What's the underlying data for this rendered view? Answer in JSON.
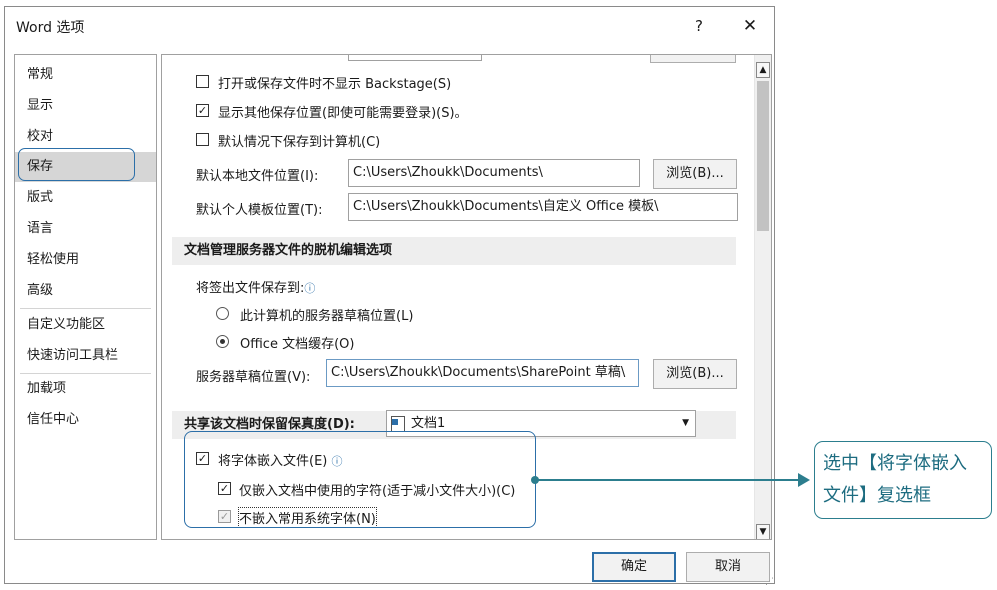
{
  "window": {
    "title": "Word 选项",
    "help": "?",
    "close": "✕"
  },
  "sidebar": {
    "items": [
      {
        "label": "常规"
      },
      {
        "label": "显示"
      },
      {
        "label": "校对"
      },
      {
        "label": "保存",
        "selected": true
      },
      {
        "label": "版式"
      },
      {
        "label": "语言"
      },
      {
        "label": "轻松使用"
      },
      {
        "label": "高级"
      },
      {
        "label": "自定义功能区"
      },
      {
        "label": "快速访问工具栏"
      },
      {
        "label": "加载项"
      },
      {
        "label": "信任中心"
      }
    ]
  },
  "save": {
    "no_backstage": {
      "label": "打开或保存文件时不显示 Backstage(S)",
      "checked": false
    },
    "show_locations": {
      "label": "显示其他保存位置(即使可能需要登录)(S)。",
      "checked": true
    },
    "default_local": {
      "label": "默认情况下保存到计算机(C)",
      "checked": false
    },
    "local_path": {
      "label": "默认本地文件位置(I):",
      "value": "C:\\Users\\Zhoukk\\Documents\\"
    },
    "template_path": {
      "label": "默认个人模板位置(T):",
      "value": "C:\\Users\\Zhoukk\\Documents\\自定义 Office 模板\\"
    },
    "browse": "浏览(B)..."
  },
  "offline": {
    "header": "文档管理服务器文件的脱机编辑选项",
    "checkout_label": "将签出文件保存到:",
    "radio_server": "此计算机的服务器草稿位置(L)",
    "radio_cache": "Office 文档缓存(O)",
    "draft_label": "服务器草稿位置(V):",
    "draft_value": "C:\\Users\\Zhoukk\\Documents\\SharePoint 草稿\\",
    "browse": "浏览(B)..."
  },
  "fidelity": {
    "header": "共享该文档时保留保真度(D):",
    "doc_name": "文档1",
    "embed_fonts": {
      "label": "将字体嵌入文件(E)",
      "checked": true
    },
    "embed_used_chars": {
      "label": "仅嵌入文档中使用的字符(适于减小文件大小)(C)",
      "checked": true
    },
    "no_common_fonts": {
      "label": "不嵌入常用系统字体(N)",
      "checked": true,
      "disabled": true
    }
  },
  "footer": {
    "ok": "确定",
    "cancel": "取消"
  },
  "callout": {
    "text": "选中【将字体嵌入文件】复选框"
  },
  "colors": {
    "accent": "#2c6fa8",
    "callout": "#2c7e8e"
  }
}
